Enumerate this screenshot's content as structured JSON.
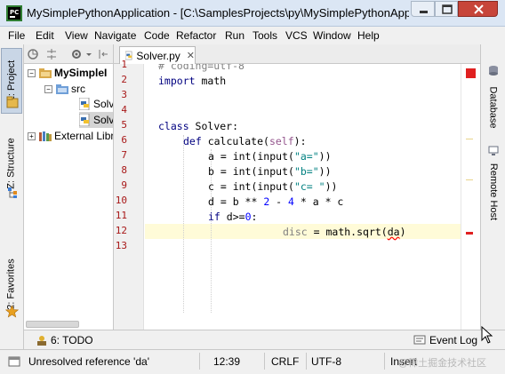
{
  "window": {
    "title": "MySimplePythonApplication - [C:\\SamplesProjects\\py\\MySimplePythonApplicat..."
  },
  "menu": [
    "File",
    "Edit",
    "View",
    "Navigate",
    "Code",
    "Refactor",
    "Run",
    "Tools",
    "VCS",
    "Window",
    "Help"
  ],
  "left_tabs": {
    "project": "1: Project",
    "structure": "Z: Structure",
    "favorites": "2: Favorites"
  },
  "right_tabs": {
    "database": "Database",
    "remote_host": "Remote Host"
  },
  "project_tree": {
    "root": "MySimpleI",
    "src": "src",
    "file1": "Solv",
    "file2": "Solv",
    "external": "External Libr"
  },
  "editor": {
    "tab_label": "Solver.py",
    "line_numbers": [
      "1",
      "2",
      "3",
      "4",
      "5",
      "6",
      "7",
      "8",
      "9",
      "10",
      "11",
      "12",
      "13"
    ],
    "code": {
      "l1": "# coding=utf-8",
      "l2_kw": "import",
      "l2_rest": " math",
      "l5_kw": "class",
      "l5_rest": " Solver:",
      "l6_kw": "def",
      "l6_name": " calculate(",
      "l6_self": "self",
      "l6_end": "):",
      "l7_a": "a = int(input(",
      "l7_s": "\"a=\"",
      "l7_b": "))",
      "l8_a": "b = int(input(",
      "l8_s": "\"b=\"",
      "l8_b": "))",
      "l9_a": "c = int(input(",
      "l9_s": "\"c= \"",
      "l9_b": "))",
      "l10_a": "d = b ** ",
      "l10_n1": "2",
      "l10_b": " - ",
      "l10_n2": "4",
      "l10_c": " * a * c",
      "l11_kw": "if",
      "l11_a": " d>=",
      "l11_n": "0",
      "l11_b": ":",
      "l12_unused": "disc",
      "l12_a": " = math.sqrt(",
      "l12_err": "da",
      "l12_b": ")"
    }
  },
  "toolwindows": {
    "todo": "6: TODO",
    "event_log": "Event Log"
  },
  "status": {
    "message": "Unresolved reference 'da'",
    "position": "12:39",
    "line_separator": "CRLF",
    "encoding": "UTF-8",
    "insert_mode": "Insert"
  },
  "watermark": "@稀土掘金技术社区",
  "colors": {
    "error": "#e02020",
    "current_line": "#fffbd8",
    "keyword": "#000080",
    "string": "#008080"
  }
}
